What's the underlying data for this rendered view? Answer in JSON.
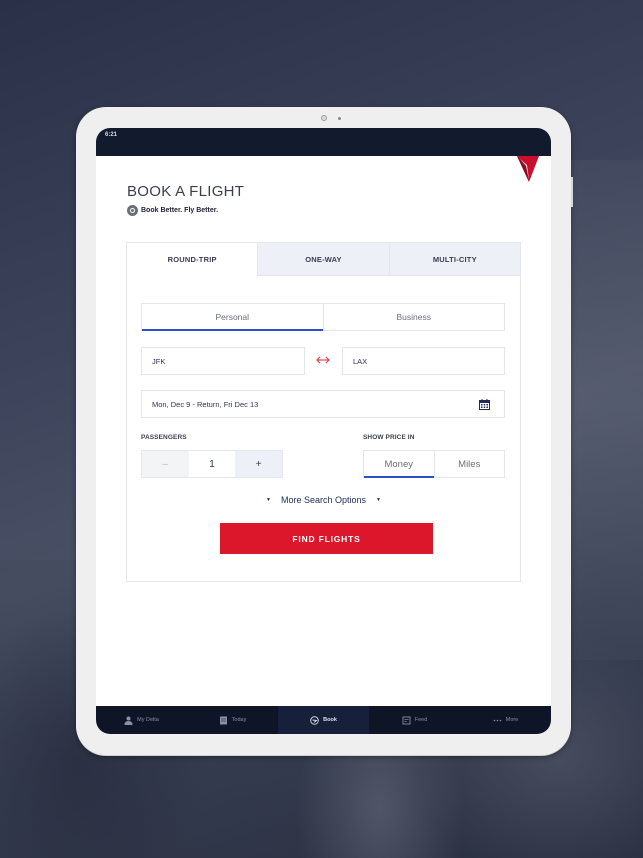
{
  "device": {
    "status_time": "6:21"
  },
  "brand": {
    "accent_red": "#dc172b",
    "accent_blue": "#2a52c8",
    "nav_dark": "#121a2d"
  },
  "header": {
    "title": "BOOK A FLIGHT",
    "tagline": "Book Better. Fly Better."
  },
  "trip_tabs": [
    {
      "label": "ROUND-TRIP",
      "active": true
    },
    {
      "label": "ONE-WAY",
      "active": false
    },
    {
      "label": "MULTI-CITY",
      "active": false
    }
  ],
  "trip_purpose": {
    "options": [
      {
        "label": "Personal",
        "active": true
      },
      {
        "label": "Business",
        "active": false
      }
    ]
  },
  "route": {
    "from": "JFK",
    "to": "LAX"
  },
  "dates": {
    "value": "Mon, Dec 9  -  Return, Fri Dec 13"
  },
  "passengers": {
    "label": "PASSENGERS",
    "minus": "–",
    "value": "1",
    "plus": "+"
  },
  "price": {
    "label": "SHOW PRICE IN",
    "options": [
      {
        "label": "Money",
        "active": true
      },
      {
        "label": "Miles",
        "active": false
      }
    ]
  },
  "more_options": {
    "label": "More Search Options",
    "caret": "▼"
  },
  "find_button": {
    "label": "FIND FLIGHTS"
  },
  "tab_bar": [
    {
      "label": "My Delta",
      "icon": "person-icon",
      "active": false
    },
    {
      "label": "Today",
      "icon": "today-icon",
      "active": false
    },
    {
      "label": "Book",
      "icon": "book-icon",
      "active": true
    },
    {
      "label": "Feed",
      "icon": "feed-icon",
      "active": false
    },
    {
      "label": "More",
      "icon": "more-icon",
      "active": false
    }
  ]
}
